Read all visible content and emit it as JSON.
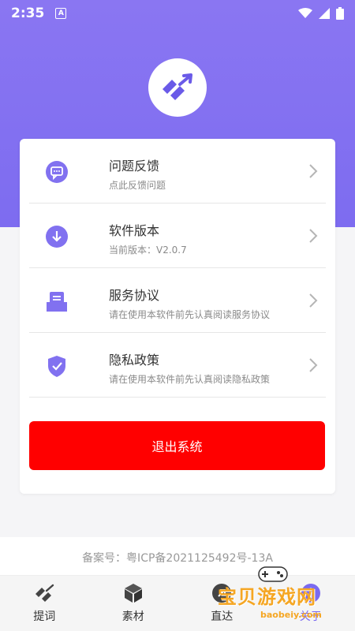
{
  "status_bar": {
    "time": "2:35",
    "notify_badge": "A"
  },
  "menu": {
    "items": [
      {
        "title": "问题反馈",
        "subtitle": "点此反馈问题",
        "icon": "feedback-icon"
      },
      {
        "title": "软件版本",
        "subtitle": "当前版本：V2.0.7",
        "icon": "download-icon"
      },
      {
        "title": "服务协议",
        "subtitle": "请在使用本软件前先认真阅读服务协议",
        "icon": "agreement-icon"
      },
      {
        "title": "隐私政策",
        "subtitle": "请在使用本软件前先认真阅读隐私政策",
        "icon": "shield-check-icon"
      }
    ]
  },
  "logout_label": "退出系统",
  "record_number": "备案号：粤ICP备2021125492号-13A",
  "tabs": [
    {
      "label": "提词",
      "icon": "prompter-icon"
    },
    {
      "label": "素材",
      "icon": "cube-icon"
    },
    {
      "label": "直达",
      "icon": "direct-icon"
    },
    {
      "label": "关于",
      "icon": "about-icon"
    }
  ],
  "watermark": {
    "text": "宝贝游戏网",
    "url": "baobeiy.com"
  },
  "colors": {
    "accent": "#7b6af0",
    "danger": "#ff0000",
    "header": "#8a76f2"
  }
}
